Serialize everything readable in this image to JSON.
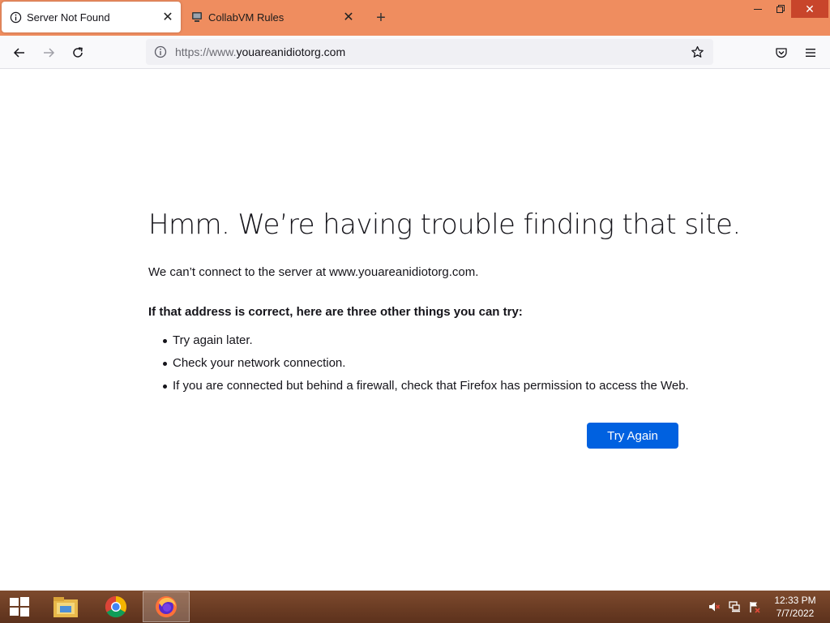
{
  "tabs": [
    {
      "title": "Server Not Found",
      "icon": "info-icon",
      "active": true
    },
    {
      "title": "CollabVM Rules",
      "icon": "collabvm-favicon-icon",
      "active": false
    }
  ],
  "toolbar": {
    "url_protocol": "https://www.",
    "url_host": "youareanidiotorg.com"
  },
  "error_page": {
    "title": "Hmm. We’re having trouble finding that site.",
    "description": "We can’t connect to the server at www.youareanidiotorg.com.",
    "suggestions_title": "If that address is correct, here are three other things you can try:",
    "suggestions": [
      "Try again later.",
      "Check your network connection.",
      "If you are connected but behind a firewall, check that Firefox has permission to access the Web."
    ],
    "try_again_label": "Try Again"
  },
  "taskbar": {
    "apps": [
      "file-explorer-icon",
      "chrome-icon",
      "firefox-icon"
    ],
    "running": "firefox-icon",
    "tray": [
      "volume-muted-icon",
      "network-icon",
      "action-center-flag-icon"
    ],
    "time": "12:33 PM",
    "date": "7/7/2022"
  },
  "colors": {
    "titlebar": "#ef8d5f",
    "accent_button": "#0061e0",
    "taskbar": "#6b3b22"
  }
}
